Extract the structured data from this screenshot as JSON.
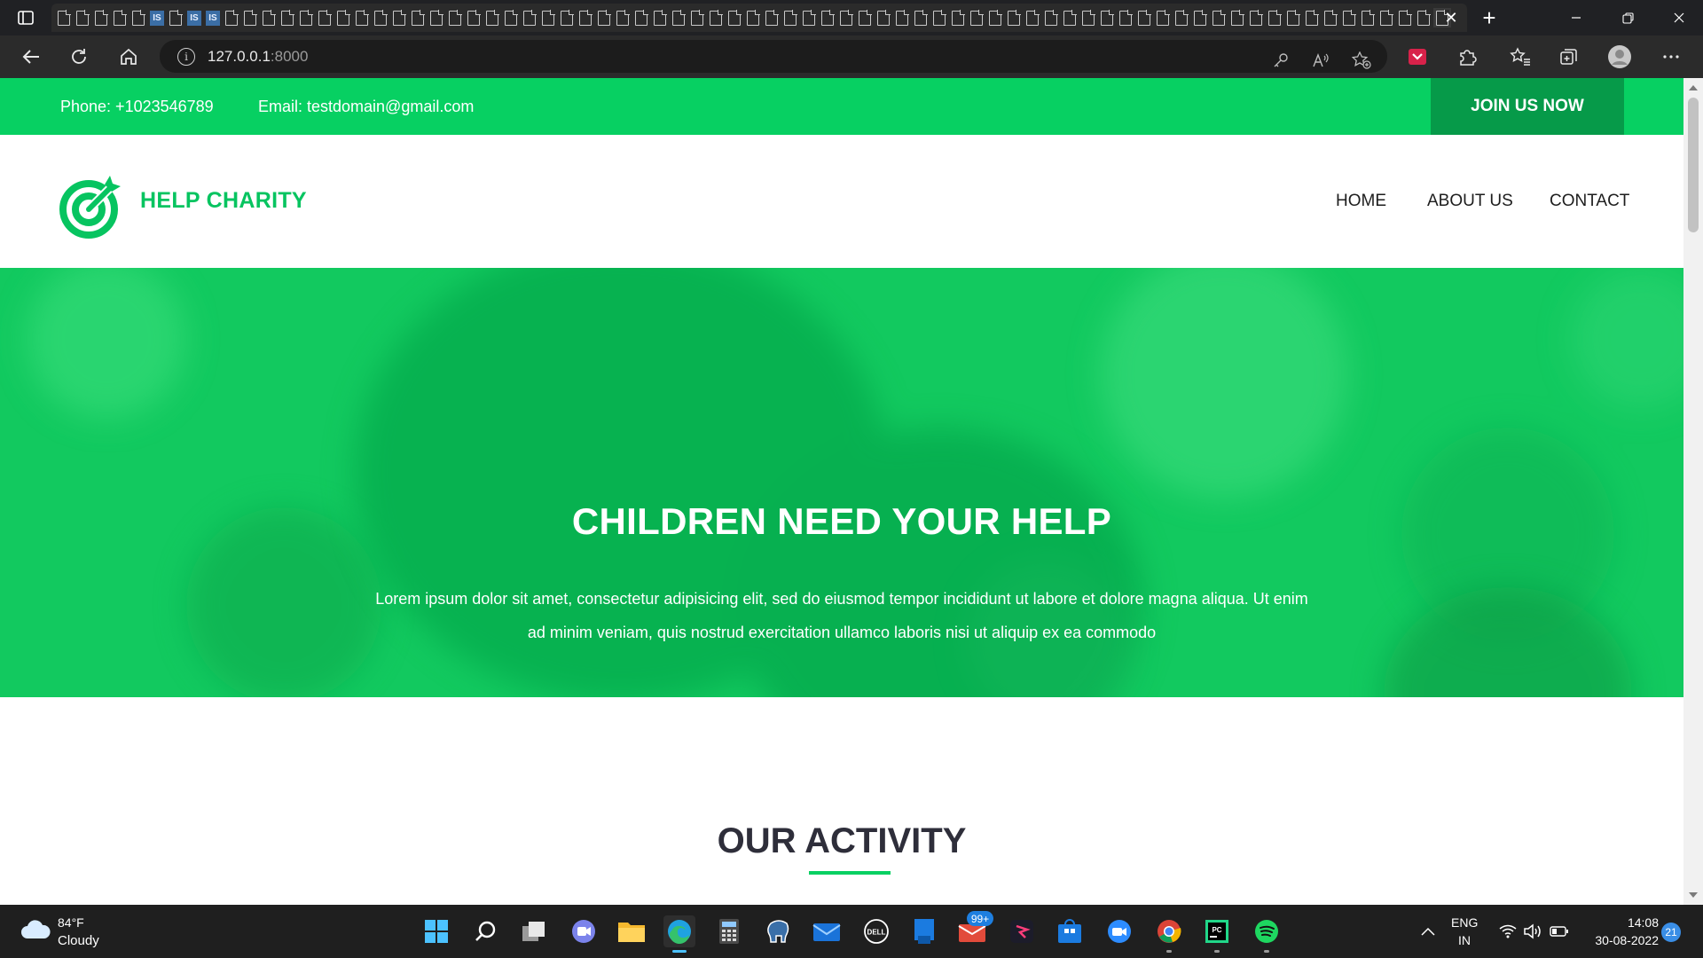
{
  "browser": {
    "url_host": "127.0.0.1",
    "url_port": ":8000",
    "tab_close": "✕",
    "new_tab": "+",
    "icons": {
      "tab_actions": "tab-actions-icon",
      "back": "back-arrow-icon",
      "refresh": "refresh-icon",
      "home": "home-icon",
      "site_info": "info-icon",
      "key": "key-icon",
      "read_aloud": "read-aloud-icon",
      "add_favorite": "add-favorite-icon",
      "extensions": "puzzle-icon",
      "favorites": "favorites-icon",
      "collections": "collections-icon",
      "profile": "profile-icon",
      "more": "more-icon"
    }
  },
  "site": {
    "topbar": {
      "phone": "Phone: +1023546789",
      "email": "Email: testdomain@gmail.com",
      "join_button": "JOIN US NOW"
    },
    "brand": "HELP CHARITY",
    "nav": [
      "HOME",
      "ABOUT US",
      "CONTACT"
    ],
    "hero": {
      "title": "CHILDREN NEED YOUR HELP",
      "text_line1": "Lorem ipsum dolor sit amet, consectetur adipisicing elit, sed do eiusmod tempor incididunt ut labore et dolore magna aliqua. Ut enim",
      "text_line2": "ad minim veniam, quis nostrud exercitation ullamco laboris nisi ut aliquip ex ea commodo"
    },
    "activity_title": "OUR ACTIVITY",
    "colors": {
      "primary": "#07d062",
      "primary_dark": "#069a49",
      "brand_text": "#07c460",
      "heading": "#2e2e3a"
    }
  },
  "taskbar": {
    "weather_temp": "84°F",
    "weather_desc": "Cloudy",
    "mail_badge": "99+",
    "lang_top": "ENG",
    "lang_bottom": "IN",
    "time": "14:08",
    "date": "30-08-2022",
    "notifications": "21"
  }
}
